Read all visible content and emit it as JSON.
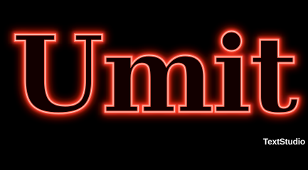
{
  "logo": {
    "text": "Umit",
    "colors": {
      "background": "#000000",
      "glow": "#ff1a0d",
      "outline": "#ff6a55",
      "highlight": "#ffd0c8",
      "fill": "#120000"
    }
  },
  "watermark": {
    "text": "TextStudio",
    "color": "#ffffff"
  }
}
